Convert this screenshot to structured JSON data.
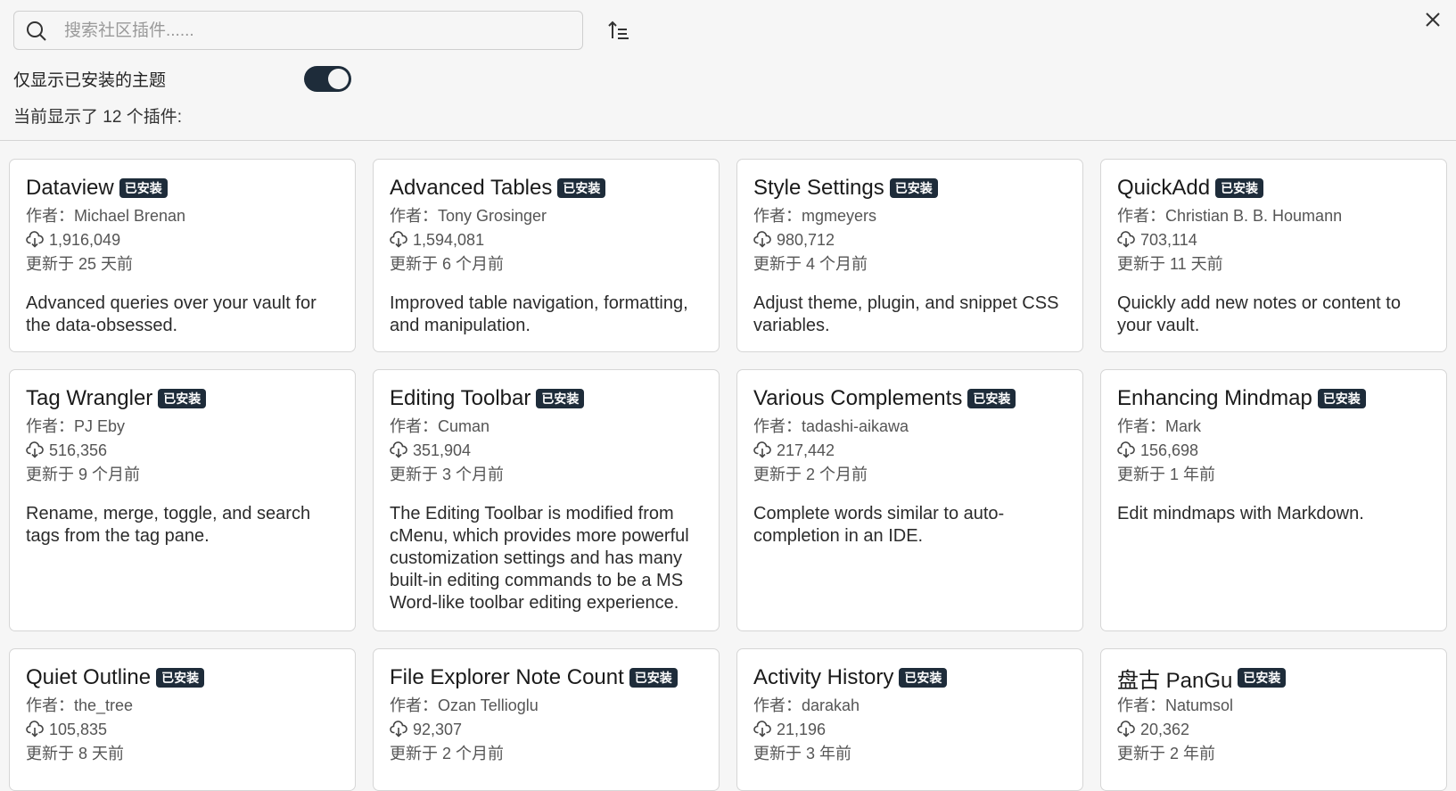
{
  "search": {
    "placeholder": "搜索社区插件......",
    "value": ""
  },
  "filter": {
    "label": "仅显示已安装的主题",
    "enabled": true
  },
  "summary": "当前显示了 12 个插件:",
  "badge_text": "已安装",
  "author_prefix": "作者：",
  "plugins": [
    {
      "name": "Dataview",
      "author": "Michael Brenan",
      "downloads": "1,916,049",
      "updated": "更新于 25 天前",
      "description": "Advanced queries over your vault for the data-obsessed."
    },
    {
      "name": "Advanced Tables",
      "author": "Tony Grosinger",
      "downloads": "1,594,081",
      "updated": "更新于 6 个月前",
      "description": "Improved table navigation, formatting, and manipulation."
    },
    {
      "name": "Style Settings",
      "author": "mgmeyers",
      "downloads": "980,712",
      "updated": "更新于 4 个月前",
      "description": "Adjust theme, plugin, and snippet CSS variables."
    },
    {
      "name": "QuickAdd",
      "author": "Christian B. B. Houmann",
      "downloads": "703,114",
      "updated": "更新于 11 天前",
      "description": "Quickly add new notes or content to your vault."
    },
    {
      "name": "Tag Wrangler",
      "author": "PJ Eby",
      "downloads": "516,356",
      "updated": "更新于 9 个月前",
      "description": "Rename, merge, toggle, and search tags from the tag pane."
    },
    {
      "name": "Editing Toolbar",
      "author": "Cuman",
      "downloads": "351,904",
      "updated": "更新于 3 个月前",
      "description": "The Editing Toolbar is modified from cMenu, which provides more powerful customization settings and has many built-in editing commands to be a MS Word-like toolbar editing experience."
    },
    {
      "name": "Various Complements",
      "author": "tadashi-aikawa",
      "downloads": "217,442",
      "updated": "更新于 2 个月前",
      "description": "Complete words similar to auto-completion in an IDE."
    },
    {
      "name": "Enhancing Mindmap",
      "author": "Mark",
      "downloads": "156,698",
      "updated": "更新于 1 年前",
      "description": "Edit mindmaps with Markdown."
    },
    {
      "name": "Quiet Outline",
      "author": "the_tree",
      "downloads": "105,835",
      "updated": "更新于 8 天前",
      "description": ""
    },
    {
      "name": "File Explorer Note Count",
      "author": "Ozan Tellioglu",
      "downloads": "92,307",
      "updated": "更新于 2 个月前",
      "description": ""
    },
    {
      "name": "Activity History",
      "author": "darakah",
      "downloads": "21,196",
      "updated": "更新于 3 年前",
      "description": ""
    },
    {
      "name": "盘古 PanGu",
      "author": "Natumsol",
      "downloads": "20,362",
      "updated": "更新于 2 年前",
      "description": ""
    }
  ]
}
